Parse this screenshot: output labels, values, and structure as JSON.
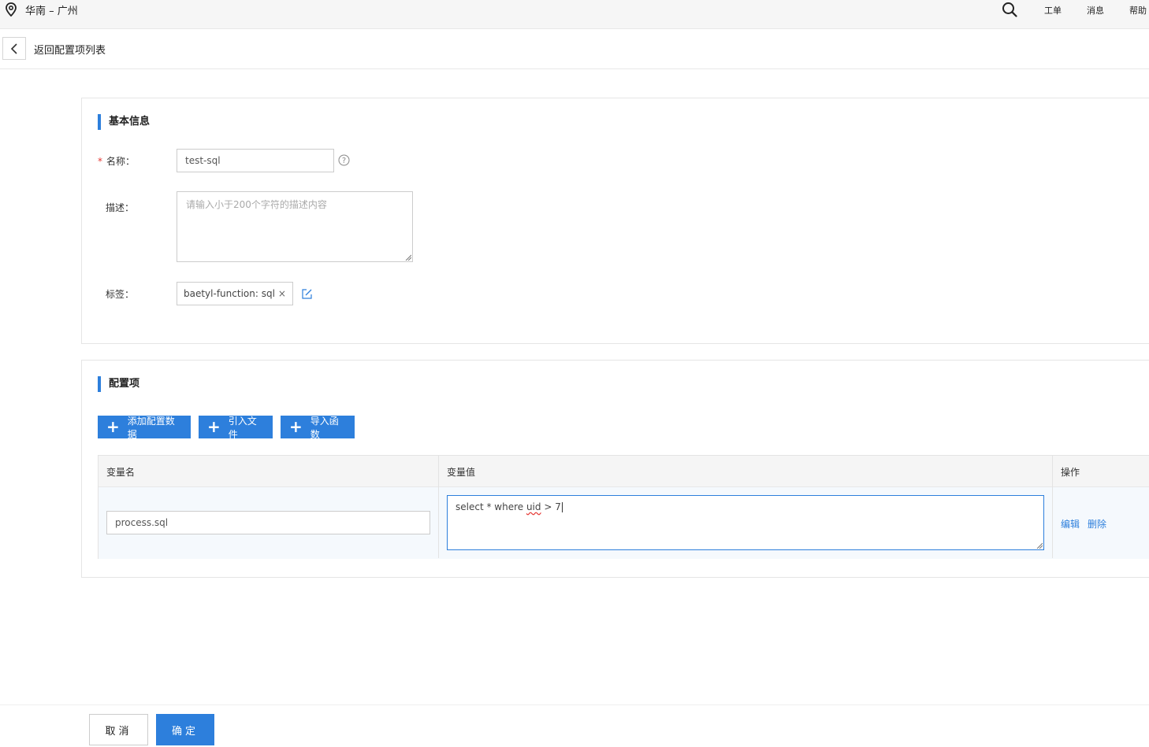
{
  "topbar": {
    "region": "华南 – 广州",
    "links": [
      "工单",
      "消息",
      "帮助"
    ]
  },
  "header": {
    "back_title": "返回配置项列表"
  },
  "basic_info": {
    "title": "基本信息",
    "name_label": "名称：",
    "required_mark": "*",
    "name_value": "test-sql",
    "desc_label": "描述：",
    "desc_placeholder": "请输入小于200个字符的描述内容",
    "tag_label": "标签：",
    "tag_text": "baetyl-function: sql",
    "tag_remove": "×"
  },
  "config": {
    "title": "配置项",
    "buttons": [
      "添加配置数据",
      "引入文件",
      "导入函数"
    ],
    "columns": [
      "变量名",
      "变量值",
      "操作"
    ],
    "rows": [
      {
        "name": "process.sql",
        "value_pre": "select * where ",
        "value_flagged": "uid",
        "value_post": " > 7",
        "actions": [
          "编辑",
          "删除"
        ]
      }
    ]
  },
  "footer": {
    "cancel_label": "取消",
    "ok_label": "确定"
  },
  "colors": {
    "accent": "#2d7fdc",
    "required": "#e53935"
  }
}
